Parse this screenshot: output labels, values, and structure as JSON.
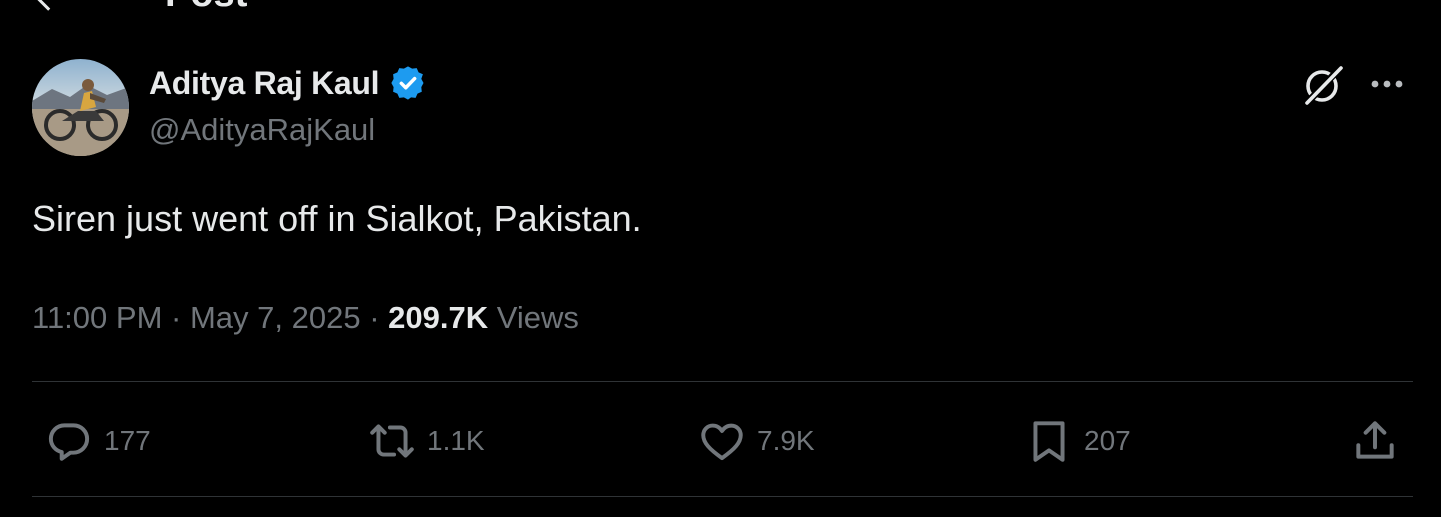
{
  "header": {
    "title": "Post",
    "back_icon": "arrow-left-icon"
  },
  "author": {
    "display_name": "Aditya Raj Kaul",
    "handle": "@AdityaRajKaul",
    "verified": true,
    "verified_color": "#1d9bf0",
    "avatar_icon": "avatar-motorcycle-photo"
  },
  "top_actions": {
    "grok_icon": "grok-icon",
    "more_icon": "more-horizontal-icon"
  },
  "post": {
    "text": "Siren just went off in Sialkot, Pakistan.",
    "time": "11:00 PM",
    "separator": "·",
    "date": "May 7, 2025",
    "views_count": "209.7K",
    "views_label": "Views"
  },
  "actions": {
    "reply": {
      "icon": "reply-icon",
      "count": "177"
    },
    "repost": {
      "icon": "repost-icon",
      "count": "1.1K"
    },
    "like": {
      "icon": "heart-icon",
      "count": "7.9K"
    },
    "bookmark": {
      "icon": "bookmark-icon",
      "count": "207"
    },
    "share": {
      "icon": "share-icon"
    }
  },
  "colors": {
    "background": "#000000",
    "primary_text": "#e7e9ea",
    "secondary_text": "#71767b",
    "divider": "#2f3336"
  }
}
